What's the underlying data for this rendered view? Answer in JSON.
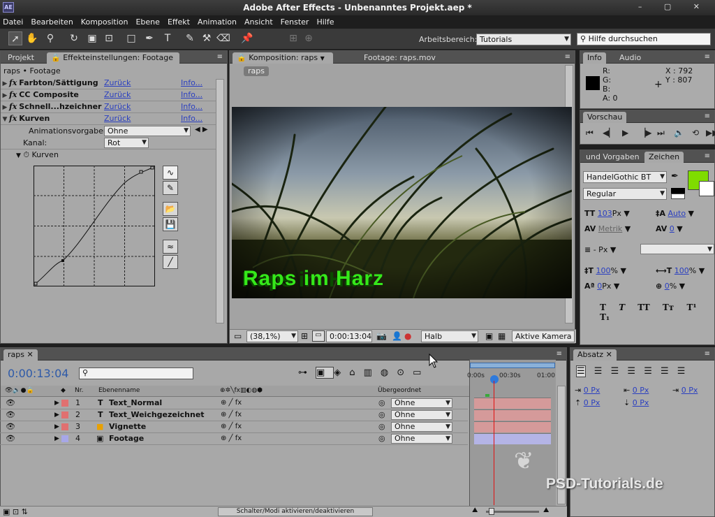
{
  "app": {
    "title": "Adobe After Effects - Unbenanntes Projekt.aep *",
    "logo": "AE",
    "window_controls": "– ▢ ✕"
  },
  "menu": [
    "Datei",
    "Bearbeiten",
    "Komposition",
    "Ebene",
    "Effekt",
    "Animation",
    "Ansicht",
    "Fenster",
    "Hilfe"
  ],
  "toolbar": {
    "workspace_label": "Arbeitsbereich:",
    "workspace_value": "Tutorials",
    "search_placeholder": "Hilfe durchsuchen"
  },
  "left_panel": {
    "tab_project": "Projekt",
    "tab_effects": "Effekteinstellungen: Footage",
    "breadcrumb": "raps • Footage",
    "effects": [
      {
        "name": "Farbton/Sättigung",
        "reset": "Zurück",
        "info": "Info..."
      },
      {
        "name": "CC Composite",
        "reset": "Zurück",
        "info": "Info..."
      },
      {
        "name": "Schnell...hzeichner",
        "reset": "Zurück",
        "info": "Info..."
      },
      {
        "name": "Kurven",
        "reset": "Zurück",
        "info": "Info..."
      }
    ],
    "presets_label": "Animationsvorgaben:",
    "presets_value": "Ohne",
    "channel_label": "Kanal:",
    "channel_value": "Rot",
    "curves_label": "Kurven"
  },
  "comp_panel": {
    "tab_comp": "Komposition: raps",
    "tab_footage": "Footage: raps.mov",
    "comp_button": "raps",
    "overlay_text": "Raps im Harz",
    "zoom": "(38,1%)",
    "timecode": "0:00:13:04",
    "resolution": "Halb",
    "camera": "Aktive Kamera"
  },
  "info_panel": {
    "tab_info": "Info",
    "tab_audio": "Audio",
    "r": "R:",
    "g": "G:",
    "b": "B:",
    "a": "A:  0",
    "x": "X : 792",
    "y": "Y : 807"
  },
  "preview_panel": {
    "tab": "Vorschau"
  },
  "char_panel": {
    "tab_presets": "und Vorgaben",
    "tab_char": "Zeichen",
    "font": "HandelGothic BT",
    "style": "Regular",
    "size": "103",
    "size_unit": "Px",
    "leading": "Auto",
    "kerning": "Metrik",
    "tracking": "0",
    "stroke_unit": "- Px",
    "vscale": "100",
    "vscale_unit": "%",
    "hscale": "100",
    "hscale_unit": "%",
    "baseline": "0",
    "baseline_unit": "Px",
    "tsume": "0",
    "tsume_unit": "%",
    "fill_color": "#7fdc00",
    "styles": [
      "T",
      "T",
      "TT",
      "Tт",
      "T¹",
      "T₁"
    ]
  },
  "paragraph_panel": {
    "tab": "Absatz",
    "values": [
      "0 Px",
      "0 Px",
      "0 Px",
      "0 Px",
      "0 Px"
    ]
  },
  "timeline": {
    "tab": "raps",
    "timecode": "0:00:13:04",
    "col_nr": "Nr.",
    "col_name": "Ebenenname",
    "col_parent": "Übergeordnet",
    "ruler": [
      "0:00s",
      "00:30s",
      "01:00"
    ],
    "toggle_label": "Schalter/Modi aktivieren/deaktivieren",
    "layers": [
      {
        "nr": "1",
        "type": "T",
        "name": "Text_Normal",
        "label_color": "#e07070",
        "parent": "Ohne",
        "bar_color": "#d59a9a"
      },
      {
        "nr": "2",
        "type": "T",
        "name": "Text_Weichgezeichnet",
        "label_color": "#e07070",
        "parent": "Ohne",
        "bar_color": "#d59a9a"
      },
      {
        "nr": "3",
        "type": "■",
        "name": "Vignette",
        "label_color": "#e07070",
        "parent": "Ohne",
        "bar_color": "#d59a9a"
      },
      {
        "nr": "4",
        "type": "▣",
        "name": "Footage",
        "label_color": "#a7a7e8",
        "parent": "Ohne",
        "bar_color": "#b4b4e6"
      }
    ]
  },
  "watermark": "PSD-Tutorials.de"
}
